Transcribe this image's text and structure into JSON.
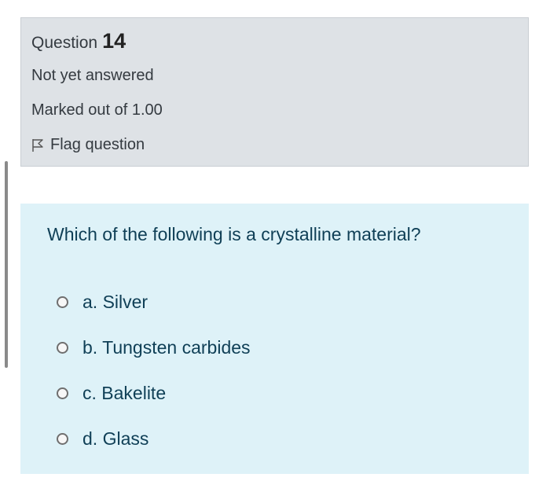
{
  "question_info": {
    "label": "Question",
    "number": "14",
    "state": "Not yet answered",
    "grade": "Marked out of 1.00",
    "flag_label": "Flag question",
    "flag_icon": "flag-outline-icon"
  },
  "question": {
    "text": "Which of the following is a crystalline material?",
    "options": [
      {
        "label": "a. Silver"
      },
      {
        "label": "b. Tungsten carbides"
      },
      {
        "label": "c. Bakelite"
      },
      {
        "label": "d. Glass"
      }
    ]
  },
  "colors": {
    "info_background": "#dee2e6",
    "content_background": "#def2f8",
    "question_text": "#0f3f56"
  }
}
